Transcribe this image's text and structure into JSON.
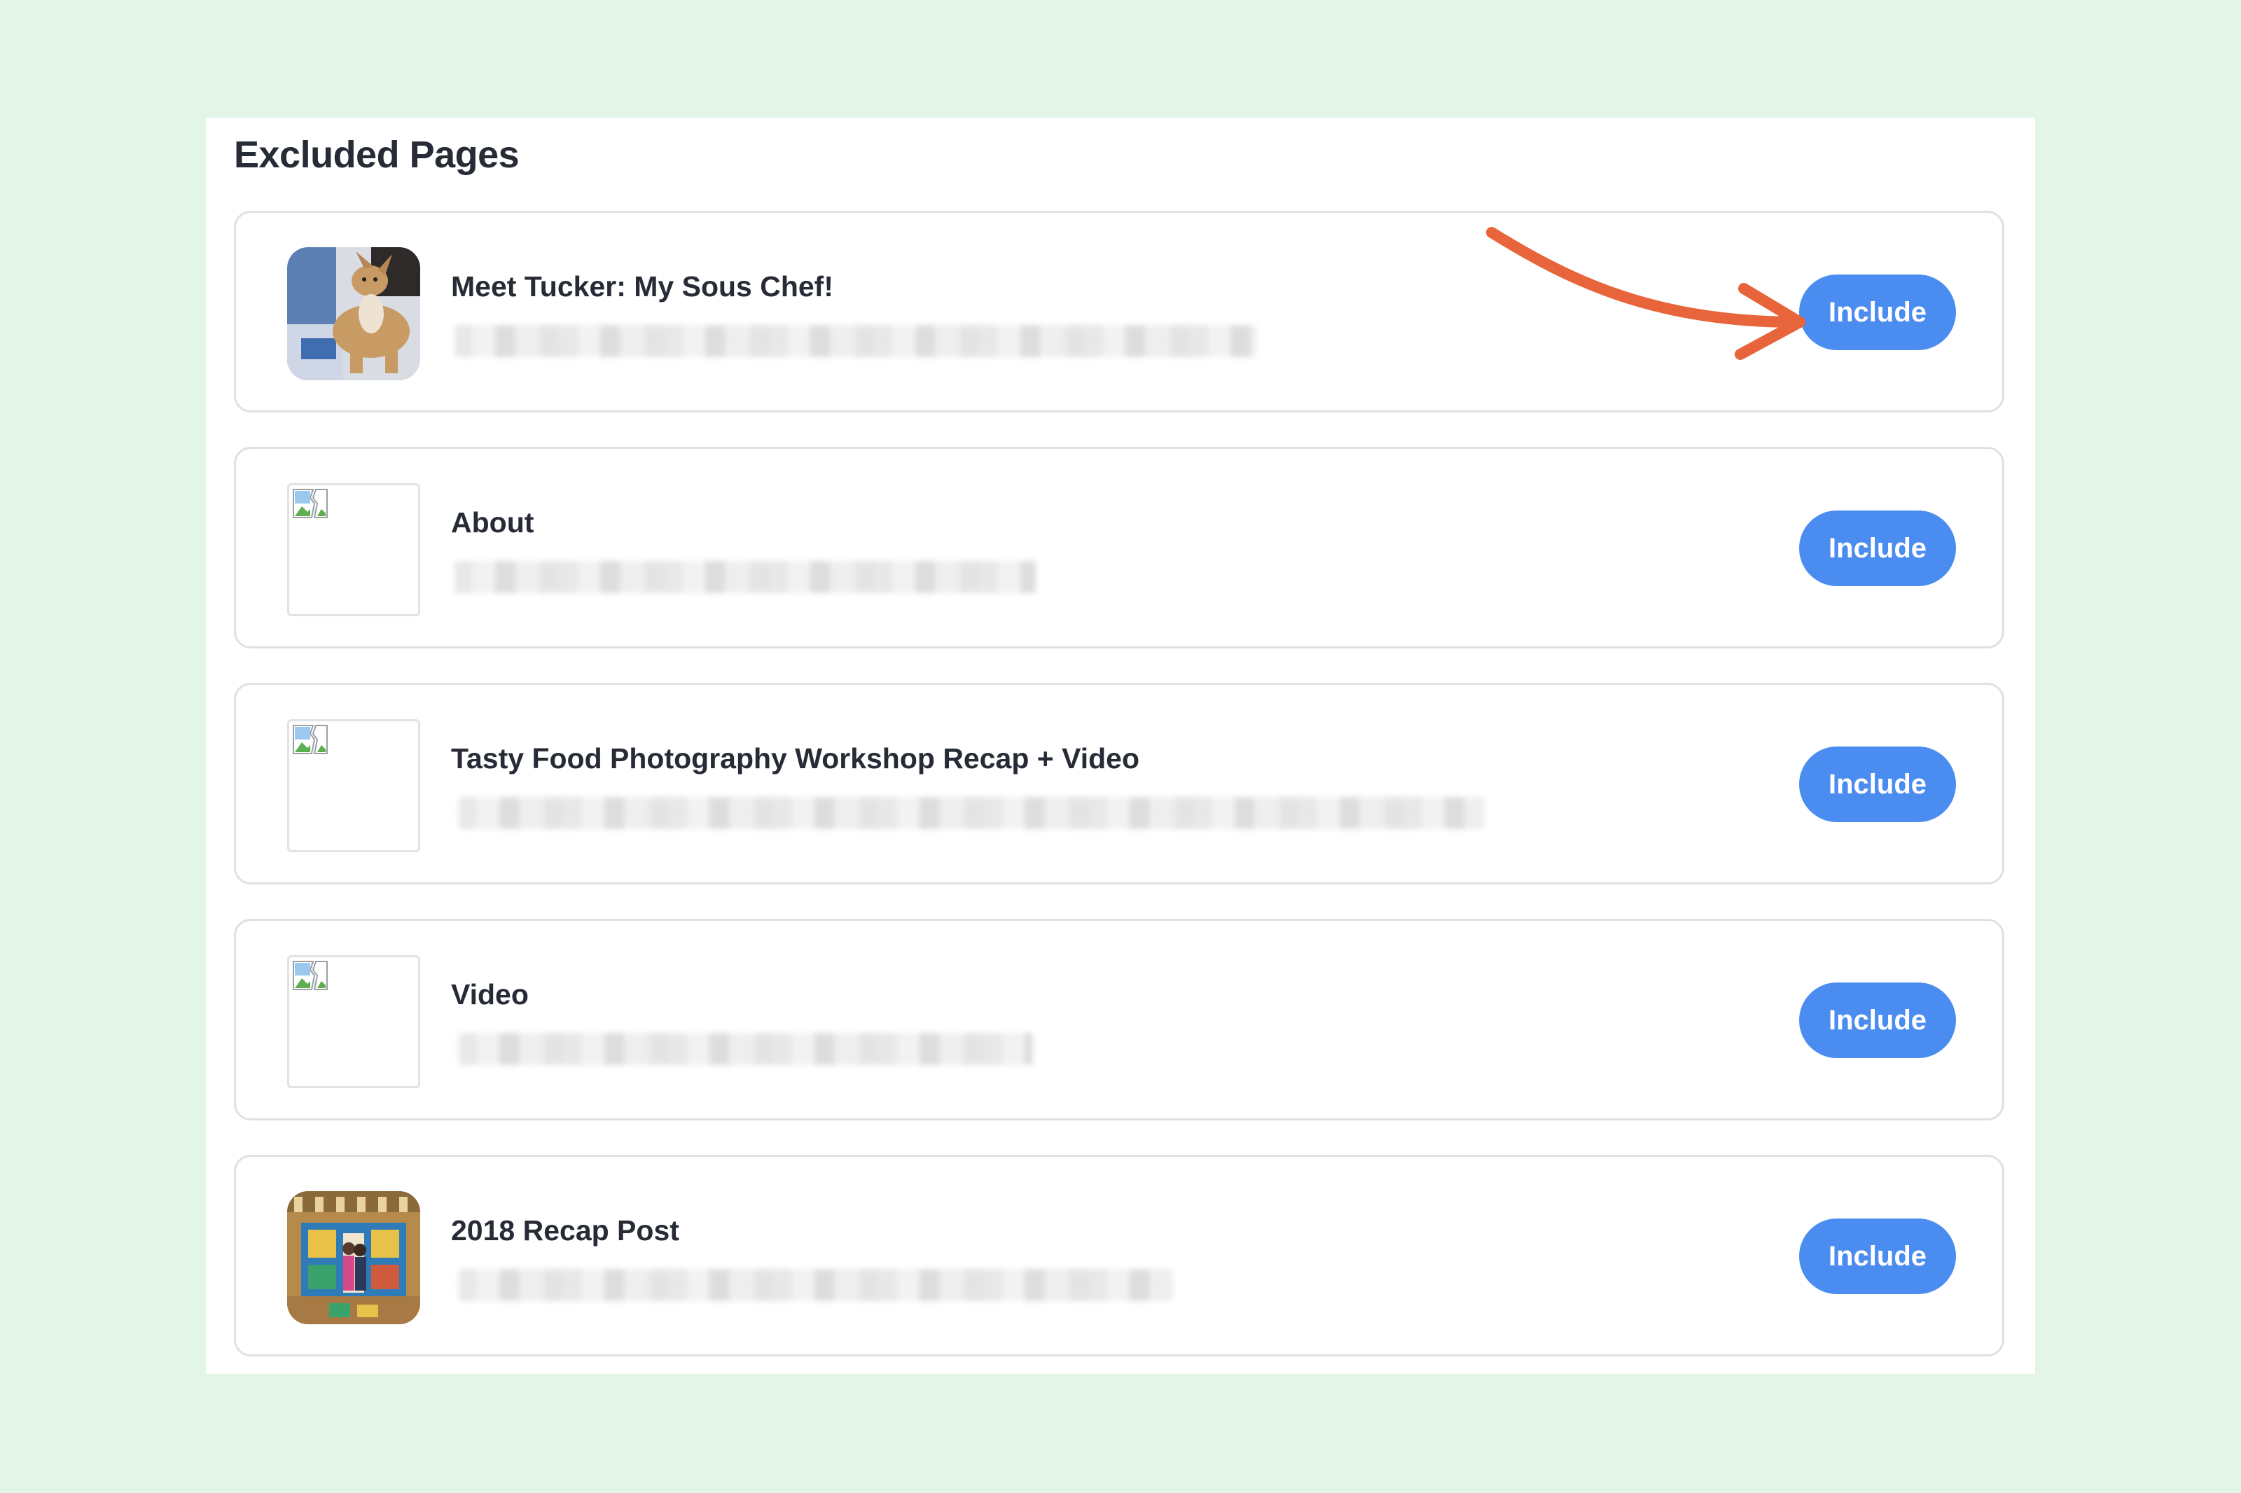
{
  "panel": {
    "title": "Excluded Pages"
  },
  "pages": [
    {
      "title": "Meet Tucker: My Sous Chef!",
      "button_label": "Include",
      "thumbnail": "dog-photo"
    },
    {
      "title": "About",
      "button_label": "Include",
      "thumbnail": "broken-image-icon"
    },
    {
      "title": "Tasty Food Photography Workshop Recap + Video",
      "button_label": "Include",
      "thumbnail": "broken-image-icon"
    },
    {
      "title": "Video",
      "button_label": "Include",
      "thumbnail": "broken-image-icon"
    },
    {
      "title": "2018 Recap Post",
      "button_label": "Include",
      "thumbnail": "tiled-plaza-photo"
    }
  ],
  "colors": {
    "background": "#e2f5e6",
    "button": "#4a8cf0",
    "annotation_arrow": "#e8643a",
    "text": "#262b36",
    "row_border": "#dfe1e6"
  }
}
